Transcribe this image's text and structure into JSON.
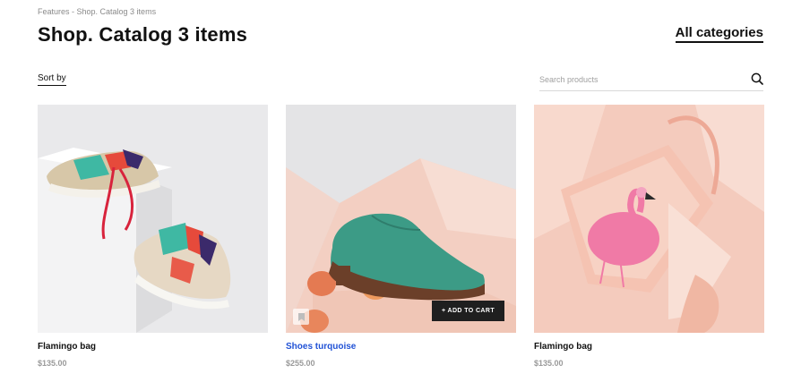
{
  "breadcrumb": "Features - Shop. Catalog 3 items",
  "page_title": "Shop. Catalog 3 items",
  "all_categories_label": "All categories",
  "sort_label": "Sort by",
  "search": {
    "placeholder": "Search products",
    "value": "",
    "icon": "search-icon"
  },
  "add_to_cart_label": "+ ADD TO CART",
  "wishlist_icon": "bookmark-icon",
  "colors": {
    "text": "#111111",
    "link": "#2152d6",
    "price": "#9a9a9a",
    "cart_button": "#1f1f1f"
  },
  "products": [
    {
      "name": "Flamingo bag",
      "price": "$135.00",
      "image": "sneakers-photo"
    },
    {
      "name": "Shoes turquoise",
      "price": "$255.00",
      "image": "green-shoe-photo"
    },
    {
      "name": "Flamingo bag",
      "price": "$135.00",
      "image": "flamingo-bag-photo"
    }
  ]
}
